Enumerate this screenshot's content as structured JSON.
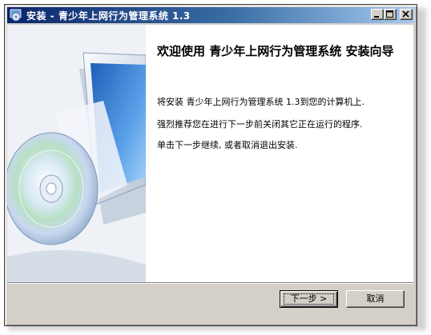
{
  "window": {
    "title": "安装 - 青少年上网行为管理系统 1.3",
    "icon": "installer-disc-icon",
    "controls": {
      "minimize_icon": "minimize-icon",
      "maximize_icon": "maximize-icon",
      "close_icon": "close-icon"
    }
  },
  "wizard": {
    "heading": "欢迎使用 青少年上网行为管理系统 安装向导",
    "paragraphs": [
      "将安装 青少年上网行为管理系统 1.3到您的计算机上.",
      "强烈推荐您在进行下一步前关闭其它正在运行的程序.",
      "单击下一步继续, 或者取消退出安装."
    ],
    "side_image": "monitor-and-cd-illustration"
  },
  "buttons": {
    "next": "下一步 >",
    "cancel": "取消"
  },
  "colors": {
    "titlebar_start": "#0a246a",
    "titlebar_end": "#a6caf0",
    "dialog_bg": "#d4d0c8",
    "content_bg": "#ffffff"
  }
}
